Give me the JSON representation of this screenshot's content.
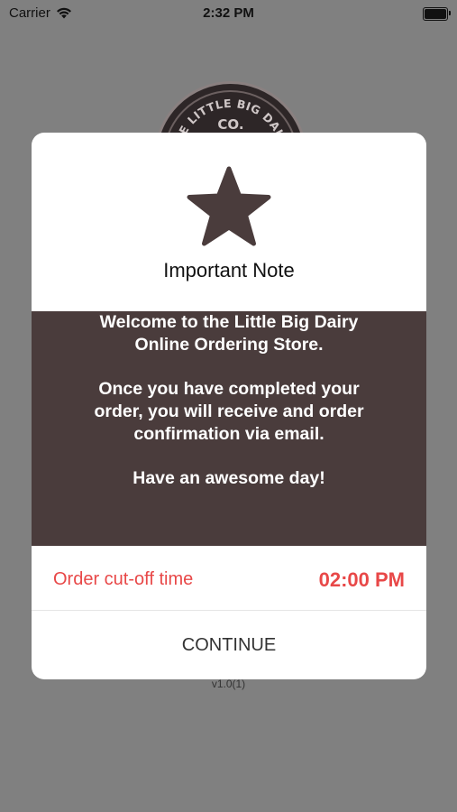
{
  "status_bar": {
    "carrier": "Carrier",
    "time": "2:32 PM"
  },
  "background": {
    "logo_top_text": "THE LITTLE BIG DAIRY",
    "logo_sub_text": "CO.",
    "version": "v1.0(1)"
  },
  "modal": {
    "icon": "star-icon",
    "title": "Important Note",
    "message": {
      "paragraph1": "Welcome to the Little Big Dairy Online Ordering Store.",
      "paragraph2": "Once you have completed your order, you will receive and order confirmation via email.",
      "paragraph3": "Have an awesome day!"
    },
    "cutoff": {
      "label": "Order cut-off time",
      "time": "02:00 PM"
    },
    "continue_label": "CONTINUE"
  },
  "colors": {
    "overlay_bg": "#808080",
    "panel_brown": "#4a3c3c",
    "accent_red": "#e84848"
  }
}
